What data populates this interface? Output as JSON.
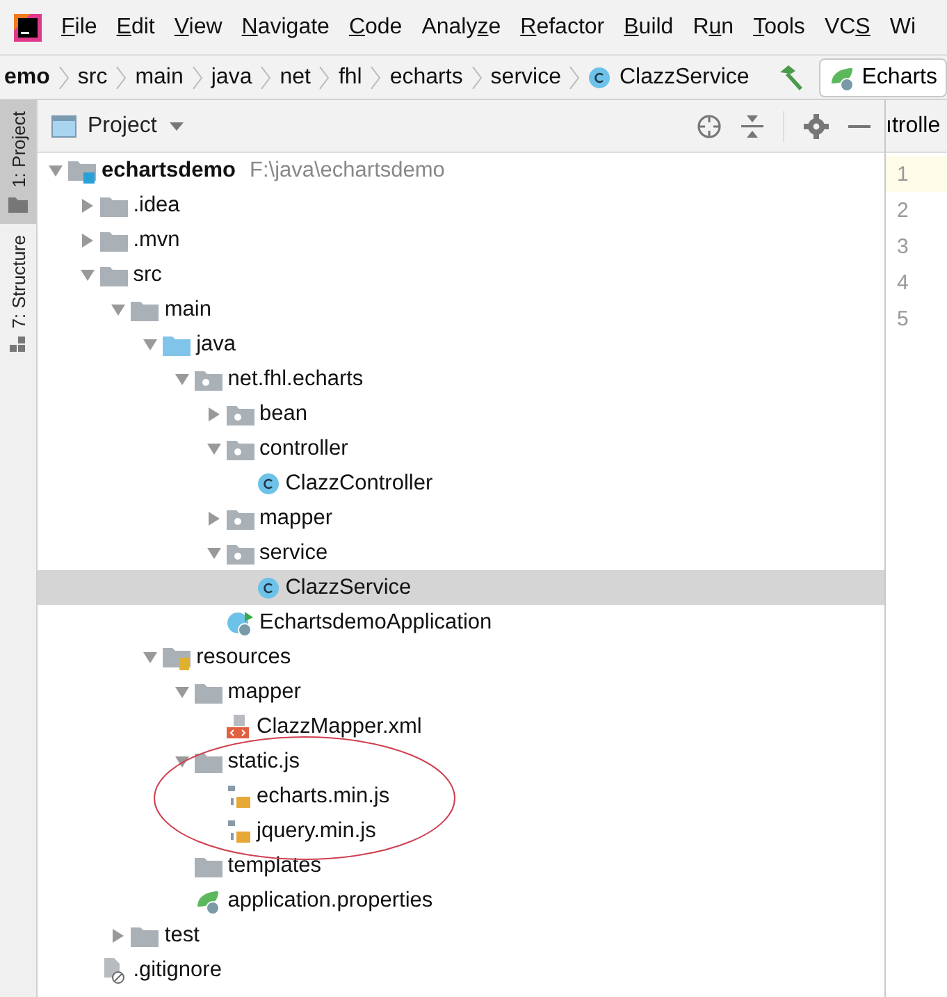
{
  "menu_bar": {
    "items": [
      {
        "parts": [
          {
            "text": "F",
            "underlined": true
          },
          {
            "text": "ile",
            "underlined": false
          }
        ]
      },
      {
        "parts": [
          {
            "text": "E",
            "underlined": true
          },
          {
            "text": "dit",
            "underlined": false
          }
        ]
      },
      {
        "parts": [
          {
            "text": "V",
            "underlined": true
          },
          {
            "text": "iew",
            "underlined": false
          }
        ]
      },
      {
        "parts": [
          {
            "text": "N",
            "underlined": true
          },
          {
            "text": "avigate",
            "underlined": false
          }
        ]
      },
      {
        "parts": [
          {
            "text": "C",
            "underlined": true
          },
          {
            "text": "ode",
            "underlined": false
          }
        ]
      },
      {
        "parts": [
          {
            "text": "Analy",
            "underlined": false
          },
          {
            "text": "z",
            "underlined": true
          },
          {
            "text": "e",
            "underlined": false
          }
        ]
      },
      {
        "parts": [
          {
            "text": "R",
            "underlined": true
          },
          {
            "text": "efactor",
            "underlined": false
          }
        ]
      },
      {
        "parts": [
          {
            "text": "B",
            "underlined": true
          },
          {
            "text": "uild",
            "underlined": false
          }
        ]
      },
      {
        "parts": [
          {
            "text": "R",
            "underlined": false
          },
          {
            "text": "u",
            "underlined": true
          },
          {
            "text": "n",
            "underlined": false
          }
        ]
      },
      {
        "parts": [
          {
            "text": "T",
            "underlined": true
          },
          {
            "text": "ools",
            "underlined": false
          }
        ]
      },
      {
        "parts": [
          {
            "text": "VC",
            "underlined": false
          },
          {
            "text": "S",
            "underlined": true
          }
        ]
      },
      {
        "parts": [
          {
            "text": "Wi",
            "underlined": false
          }
        ]
      }
    ]
  },
  "breadcrumbs": [
    {
      "label": "emo",
      "kind": "project"
    },
    {
      "label": "src",
      "kind": "folder"
    },
    {
      "label": "main",
      "kind": "folder"
    },
    {
      "label": "java",
      "kind": "folder"
    },
    {
      "label": "net",
      "kind": "folder"
    },
    {
      "label": "fhl",
      "kind": "folder"
    },
    {
      "label": "echarts",
      "kind": "folder"
    },
    {
      "label": "service",
      "kind": "folder"
    },
    {
      "label": "ClazzService",
      "kind": "class"
    }
  ],
  "run_config": {
    "label": "Echarts"
  },
  "tool_strip": [
    {
      "label": "1: Project",
      "selected": true
    },
    {
      "label": "7: Structure",
      "selected": false
    }
  ],
  "project_panel": {
    "title": "Project",
    "tree": [
      {
        "label": "echartsdemo",
        "path": "F:\\java\\echartsdemo",
        "kind": "project",
        "expanded": true,
        "selected": false,
        "children": [
          {
            "label": ".idea",
            "kind": "folder",
            "expanded": false,
            "selected": false
          },
          {
            "label": ".mvn",
            "kind": "folder",
            "expanded": false,
            "selected": false
          },
          {
            "label": "src",
            "kind": "folder",
            "expanded": true,
            "selected": false,
            "children": [
              {
                "label": "main",
                "kind": "folder",
                "expanded": true,
                "selected": false,
                "children": [
                  {
                    "label": "java",
                    "kind": "source",
                    "expanded": true,
                    "selected": false,
                    "children": [
                      {
                        "label": "net.fhl.echarts",
                        "kind": "package",
                        "expanded": true,
                        "selected": false,
                        "children": [
                          {
                            "label": "bean",
                            "kind": "package",
                            "expanded": false,
                            "selected": false
                          },
                          {
                            "label": "controller",
                            "kind": "package",
                            "expanded": true,
                            "selected": false,
                            "children": [
                              {
                                "label": "ClazzController",
                                "kind": "class",
                                "selected": false
                              }
                            ]
                          },
                          {
                            "label": "mapper",
                            "kind": "package",
                            "expanded": false,
                            "selected": false
                          },
                          {
                            "label": "service",
                            "kind": "package",
                            "expanded": true,
                            "selected": false,
                            "children": [
                              {
                                "label": "ClazzService",
                                "kind": "class",
                                "selected": true
                              }
                            ]
                          },
                          {
                            "label": "EchartsdemoApplication",
                            "kind": "spring-class",
                            "selected": false
                          }
                        ]
                      }
                    ]
                  },
                  {
                    "label": "resources",
                    "kind": "resources",
                    "expanded": true,
                    "selected": false,
                    "children": [
                      {
                        "label": "mapper",
                        "kind": "folder",
                        "expanded": true,
                        "selected": false,
                        "children": [
                          {
                            "label": "ClazzMapper.xml",
                            "kind": "xml",
                            "selected": false
                          }
                        ]
                      },
                      {
                        "label": "static.js",
                        "kind": "folder",
                        "expanded": true,
                        "selected": false,
                        "children": [
                          {
                            "label": "echarts.min.js",
                            "kind": "js",
                            "selected": false
                          },
                          {
                            "label": "jquery.min.js",
                            "kind": "js",
                            "selected": false
                          }
                        ]
                      },
                      {
                        "label": "templates",
                        "kind": "folder",
                        "selected": false
                      },
                      {
                        "label": "application.properties",
                        "kind": "properties",
                        "selected": false
                      }
                    ]
                  }
                ]
              },
              {
                "label": "test",
                "kind": "folder",
                "expanded": false,
                "selected": false
              }
            ]
          },
          {
            "label": ".gitignore",
            "kind": "ignore",
            "selected": false
          }
        ]
      }
    ]
  },
  "editor": {
    "tab": "ıtrolle",
    "line_numbers": [
      {
        "label": "1",
        "selected": true
      },
      {
        "label": "2",
        "selected": false
      },
      {
        "label": "3",
        "selected": false
      },
      {
        "label": "4",
        "selected": false
      },
      {
        "label": "5",
        "selected": false
      }
    ]
  }
}
